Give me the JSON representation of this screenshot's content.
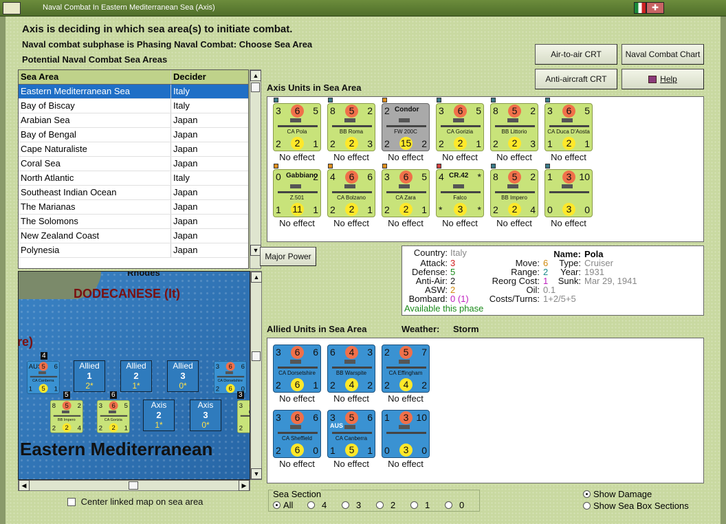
{
  "window": {
    "title": "Naval Combat In Eastern Mediterranean Sea (Axis)",
    "flag_label": "✚"
  },
  "header": {
    "line1": "Axis is deciding in which sea area(s) to initiate combat.",
    "line2": "Naval combat subphase is Phasing Naval Combat: Choose Sea Area",
    "line3": "Potential Naval Combat Sea Areas"
  },
  "buttons": {
    "air_to_air": "Air-to-air CRT",
    "naval_chart": "Naval Combat Chart",
    "anti_aircraft": "Anti-aircraft CRT",
    "help": "Help",
    "major_power": "Major Power"
  },
  "sea_table": {
    "headers": [
      "Sea Area",
      "Decider"
    ],
    "rows": [
      [
        "Eastern Mediterranean Sea",
        "Italy"
      ],
      [
        "Bay of Biscay",
        "Italy"
      ],
      [
        "Arabian Sea",
        "Japan"
      ],
      [
        "Bay of Bengal",
        "Japan"
      ],
      [
        "Cape Naturaliste",
        "Japan"
      ],
      [
        "Coral Sea",
        "Japan"
      ],
      [
        "North Atlantic",
        "Italy"
      ],
      [
        "Southeast Indian Ocean",
        "Japan"
      ],
      [
        "The Marianas",
        "Japan"
      ],
      [
        "The Solomons",
        "Japan"
      ],
      [
        "New Zealand Coast",
        "Japan"
      ],
      [
        "Polynesia",
        "Japan"
      ]
    ]
  },
  "map": {
    "label_rhodes": "Rhodes",
    "label_dodecanese": "DODECANESE (It)",
    "label_re": "re)",
    "label_sea": "Eastern Mediterranean",
    "allied_boxes": [
      {
        "name": "Allied",
        "num": "1",
        "val": "2*"
      },
      {
        "name": "Allied",
        "num": "2",
        "val": "1*"
      },
      {
        "name": "Allied",
        "num": "3",
        "val": "0*"
      }
    ],
    "axis_boxes": [
      {
        "name": "Axis",
        "num": "2",
        "val": "1*"
      },
      {
        "name": "Axis",
        "num": "3",
        "val": "0*"
      }
    ],
    "stack_counts": [
      "4",
      "5",
      "6",
      "3"
    ],
    "mini_counters": [
      {
        "tl": "AUS",
        "tc": "5",
        "tr": "6",
        "name": "CA Canberra",
        "bl": "1",
        "bc": "5",
        "br": "1"
      },
      {
        "tl": "3",
        "tc": "6",
        "tr": "6",
        "name": "CA Dorsetshire",
        "bl": "2",
        "bc": "6",
        "br": "0"
      },
      {
        "tl": "8",
        "tc": "5",
        "tr": "2",
        "name": "BB Impero",
        "bl": "2",
        "bc": "2",
        "br": "4"
      },
      {
        "tl": "3",
        "tc": "6",
        "tr": "5",
        "name": "CA Gorizia",
        "bl": "2",
        "bc": "2",
        "br": "1"
      },
      {
        "tl": "3",
        "tc": "6",
        "tr": "",
        "name": "",
        "bl": "2",
        "bc": "",
        "br": ""
      }
    ],
    "center_linked_label": "Center linked map on sea area"
  },
  "axis_units": {
    "title": "Axis Units in Sea Area",
    "units": [
      {
        "tl": "3",
        "tc": "6",
        "tr": "5",
        "name": "CA Pola",
        "bl": "2",
        "bc": "2",
        "br": "1",
        "effect": "No effect"
      },
      {
        "tl": "8",
        "tc": "5",
        "tr": "2",
        "name": "BB Roma",
        "bl": "2",
        "bc": "2",
        "br": "3",
        "effect": "No effect"
      },
      {
        "tl": "2",
        "tc": "Condor",
        "tr": "",
        "name": "FW 200C",
        "bl": "2",
        "bc": "15",
        "br": "2",
        "effect": "No effect"
      },
      {
        "tl": "3",
        "tc": "6",
        "tr": "5",
        "name": "CA Gorizia",
        "bl": "2",
        "bc": "2",
        "br": "1",
        "effect": "No effect"
      },
      {
        "tl": "8",
        "tc": "5",
        "tr": "2",
        "name": "BB Littorio",
        "bl": "2",
        "bc": "2",
        "br": "3",
        "effect": "No effect"
      },
      {
        "tl": "3",
        "tc": "6",
        "tr": "5",
        "name": "CA Duca D'Aosta",
        "bl": "1",
        "bc": "2",
        "br": "1",
        "effect": "No effect"
      },
      {
        "tl": "0",
        "tc": "Gabbiano",
        "tr": "2",
        "name": "Z.501",
        "bl": "1",
        "bc": "11",
        "br": "1",
        "effect": "No effect"
      },
      {
        "tl": "4",
        "tc": "6",
        "tr": "6",
        "name": "CA Bolzano",
        "bl": "2",
        "bc": "2",
        "br": "1",
        "effect": "No effect"
      },
      {
        "tl": "3",
        "tc": "6",
        "tr": "5",
        "name": "CA Zara",
        "bl": "2",
        "bc": "2",
        "br": "1",
        "effect": "No effect"
      },
      {
        "tl": "4",
        "tc": "CR.42",
        "tr": "*",
        "name": "Falco",
        "bl": "*",
        "bc": "3",
        "br": "*",
        "effect": "No effect"
      },
      {
        "tl": "8",
        "tc": "5",
        "tr": "2",
        "name": "BB Impero",
        "bl": "2",
        "bc": "2",
        "br": "4",
        "effect": "No effect"
      },
      {
        "tl": "1",
        "tc": "3",
        "tr": "10",
        "name": "",
        "bl": "0",
        "bc": "3",
        "br": "0",
        "effect": "No effect"
      }
    ]
  },
  "unit_info": {
    "country_label": "Country:",
    "country": "Italy",
    "attack_label": "Attack:",
    "attack": "3",
    "defense_label": "Defense:",
    "defense": "5",
    "antiair_label": "Anti-Air:",
    "antiair": "2",
    "asw_label": "ASW:",
    "asw": "2",
    "bombard_label": "Bombard:",
    "bombard": "0 (1)",
    "move_label": "Move:",
    "move": "6",
    "range_label": "Range:",
    "range": "2",
    "reorg_label": "Reorg Cost:",
    "reorg": "1",
    "oil_label": "Oil:",
    "oil": "0.1",
    "costs_label": "Costs/Turns:",
    "costs": "1+2/5+5",
    "name_label": "Name:",
    "name": "Pola",
    "type_label": "Type:",
    "type": "Cruiser",
    "year_label": "Year:",
    "year": "1931",
    "sunk_label": "Sunk:",
    "sunk": "Mar 29, 1941",
    "status": "Available this phase"
  },
  "allied_units": {
    "title": "Allied Units in Sea Area",
    "weather_label": "Weather:",
    "weather": "Storm",
    "units": [
      {
        "tl": "3",
        "tc": "6",
        "tr": "6",
        "name": "CA Dorsetshire",
        "bl": "2",
        "bc": "6",
        "br": "1",
        "effect": "No effect"
      },
      {
        "tl": "6",
        "tc": "4",
        "tr": "3",
        "name": "BB Warspite",
        "bl": "2",
        "bc": "4",
        "br": "2",
        "effect": "No effect"
      },
      {
        "tl": "2",
        "tc": "5",
        "tr": "7",
        "name": "CA Effingham",
        "bl": "2",
        "bc": "4",
        "br": "2",
        "effect": "No effect"
      },
      {
        "tl": "3",
        "tc": "6",
        "tr": "6",
        "name": "CA Sheffield",
        "bl": "2",
        "bc": "6",
        "br": "0",
        "effect": "No effect"
      },
      {
        "tl": "3",
        "tc": "5",
        "tr": "6",
        "name": "CA Canberra",
        "bl": "1",
        "bc": "5",
        "br": "1",
        "effect": "No effect",
        "flag": "AUS"
      },
      {
        "tl": "1",
        "tc": "3",
        "tr": "10",
        "name": "",
        "bl": "0",
        "bc": "3",
        "br": "0",
        "effect": "No effect"
      }
    ]
  },
  "sea_section": {
    "title": "Sea Section",
    "options": [
      "All",
      "4",
      "3",
      "2",
      "1",
      "0"
    ]
  },
  "display_options": {
    "show_damage": "Show Damage",
    "show_sea_box": "Show Sea Box Sections"
  }
}
